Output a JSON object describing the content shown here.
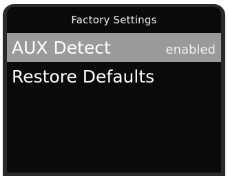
{
  "screen": {
    "title": "Factory Settings"
  },
  "menu": {
    "items": [
      {
        "label": "AUX Detect",
        "value": "enabled",
        "selected": true
      },
      {
        "label": "Restore Defaults",
        "value": "",
        "selected": false
      }
    ]
  },
  "colors": {
    "screen_background": "#0a0a0a",
    "bezel": "#2a2a2a",
    "selection_highlight": "#9a9a9a",
    "text": "#ffffff"
  }
}
